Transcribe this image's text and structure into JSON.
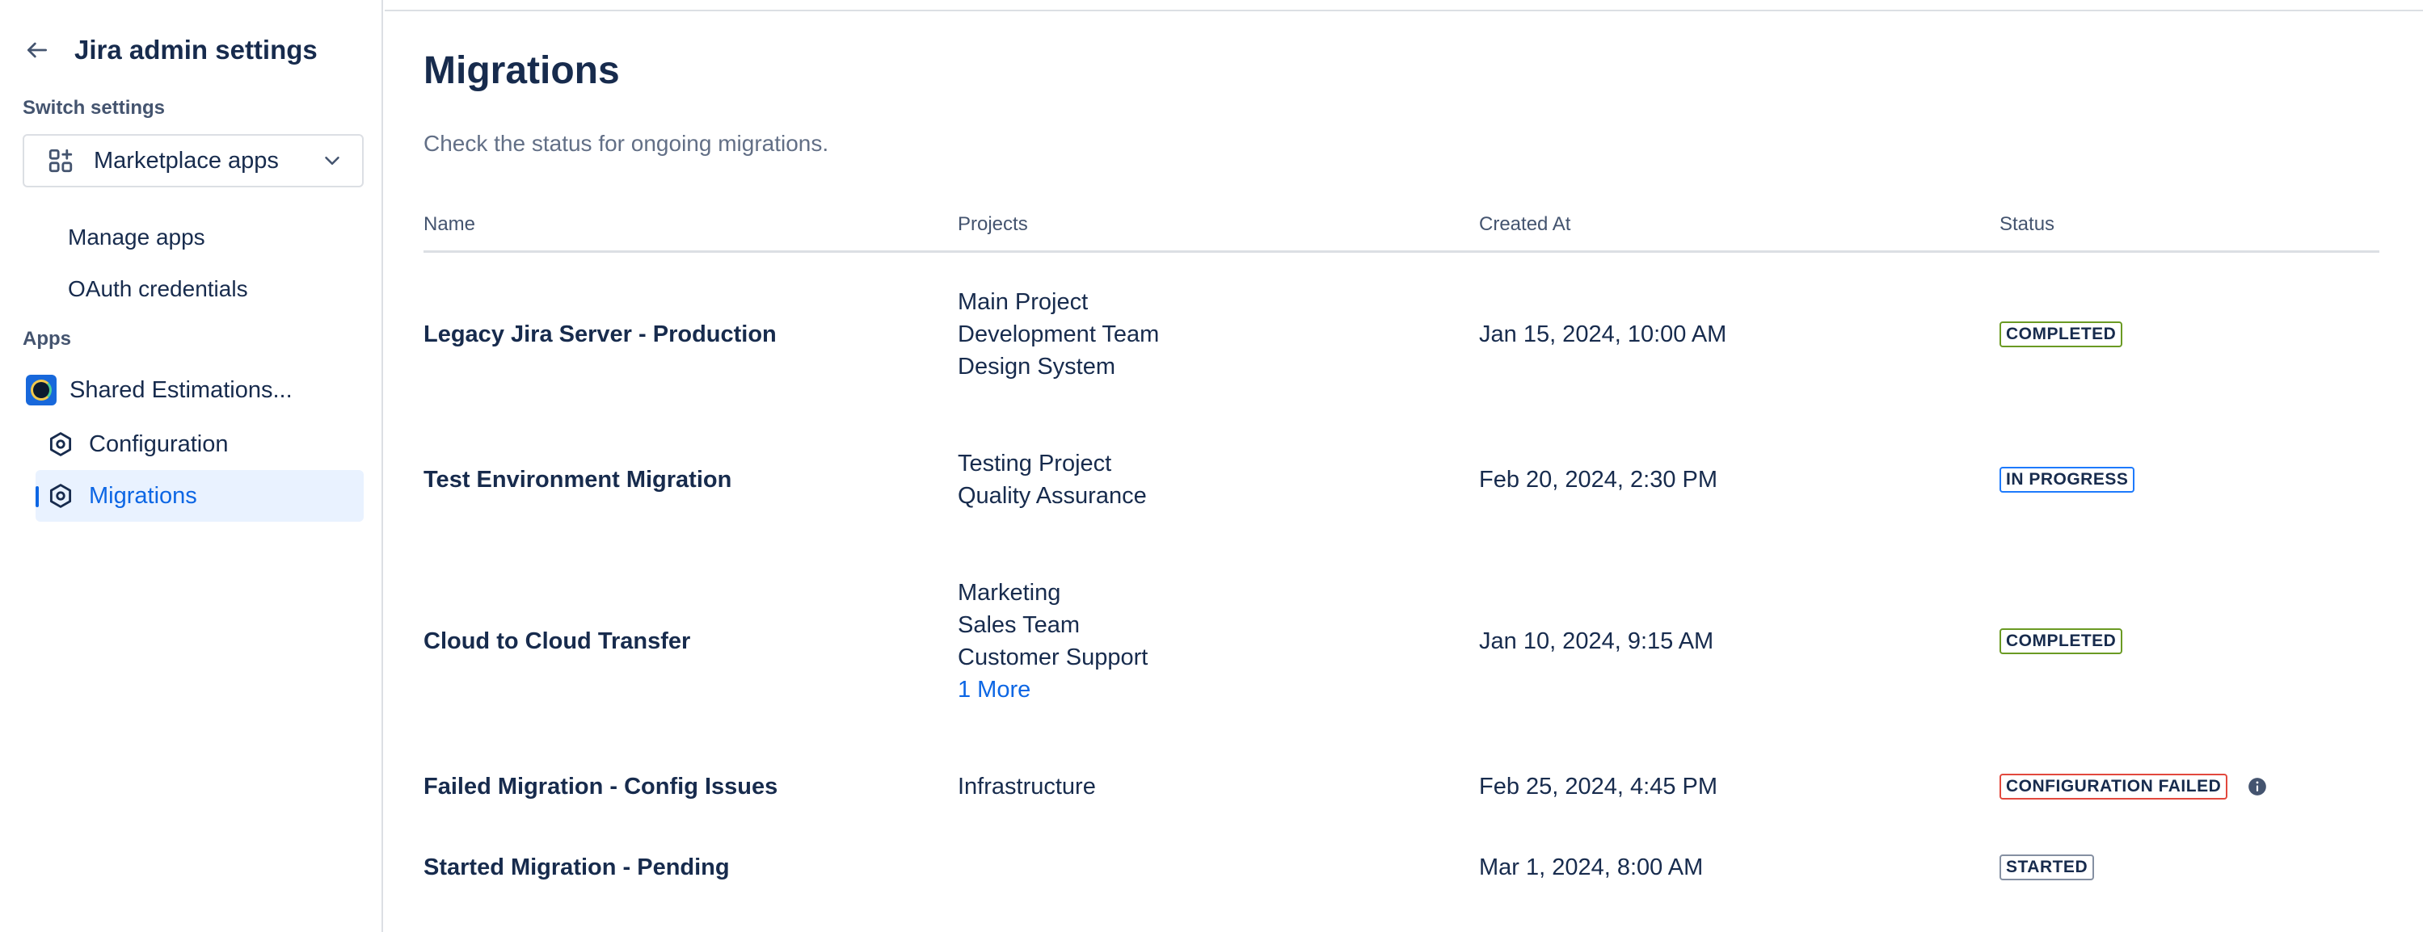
{
  "sidebar": {
    "title": "Jira admin settings",
    "switch_label": "Switch settings",
    "switch_select": {
      "value": "Marketplace apps",
      "icon": "apps-icon"
    },
    "links": [
      {
        "label": "Manage apps"
      },
      {
        "label": "OAuth credentials"
      }
    ],
    "apps_label": "Apps",
    "app": {
      "name": "Shared Estimations..."
    },
    "nav": [
      {
        "label": "Configuration",
        "active": false,
        "icon": "hexagon-icon"
      },
      {
        "label": "Migrations",
        "active": true,
        "icon": "hexagon-icon"
      }
    ]
  },
  "main": {
    "title": "Migrations",
    "description": "Check the status for ongoing migrations.",
    "columns": [
      "Name",
      "Projects",
      "Created At",
      "Status"
    ],
    "rows": [
      {
        "name": "Legacy Jira Server - Production",
        "projects": [
          "Main Project",
          "Development Team",
          "Design System"
        ],
        "more": "",
        "created_at": "Jan 15, 2024, 10:00 AM",
        "status": "COMPLETED"
      },
      {
        "name": "Test Environment Migration",
        "projects": [
          "Testing Project",
          "Quality Assurance"
        ],
        "more": "",
        "created_at": "Feb 20, 2024, 2:30 PM",
        "status": "IN PROGRESS"
      },
      {
        "name": "Cloud to Cloud Transfer",
        "projects": [
          "Marketing",
          "Sales Team",
          "Customer Support"
        ],
        "more": "1 More",
        "created_at": "Jan 10, 2024, 9:15 AM",
        "status": "COMPLETED"
      },
      {
        "name": "Failed Migration - Config Issues",
        "projects": [
          "Infrastructure"
        ],
        "more": "",
        "created_at": "Feb 25, 2024, 4:45 PM",
        "status": "CONFIGURATION FAILED"
      },
      {
        "name": "Started Migration - Pending",
        "projects": [],
        "more": "",
        "created_at": "Mar 1, 2024, 8:00 AM",
        "status": "STARTED"
      }
    ]
  },
  "colors": {
    "completed": "#6a9a23",
    "in_progress": "#1d7afc",
    "failed": "#e2483d",
    "started": "#8590a2",
    "link": "#0c66e4",
    "active_bg": "#e9f2ff"
  }
}
